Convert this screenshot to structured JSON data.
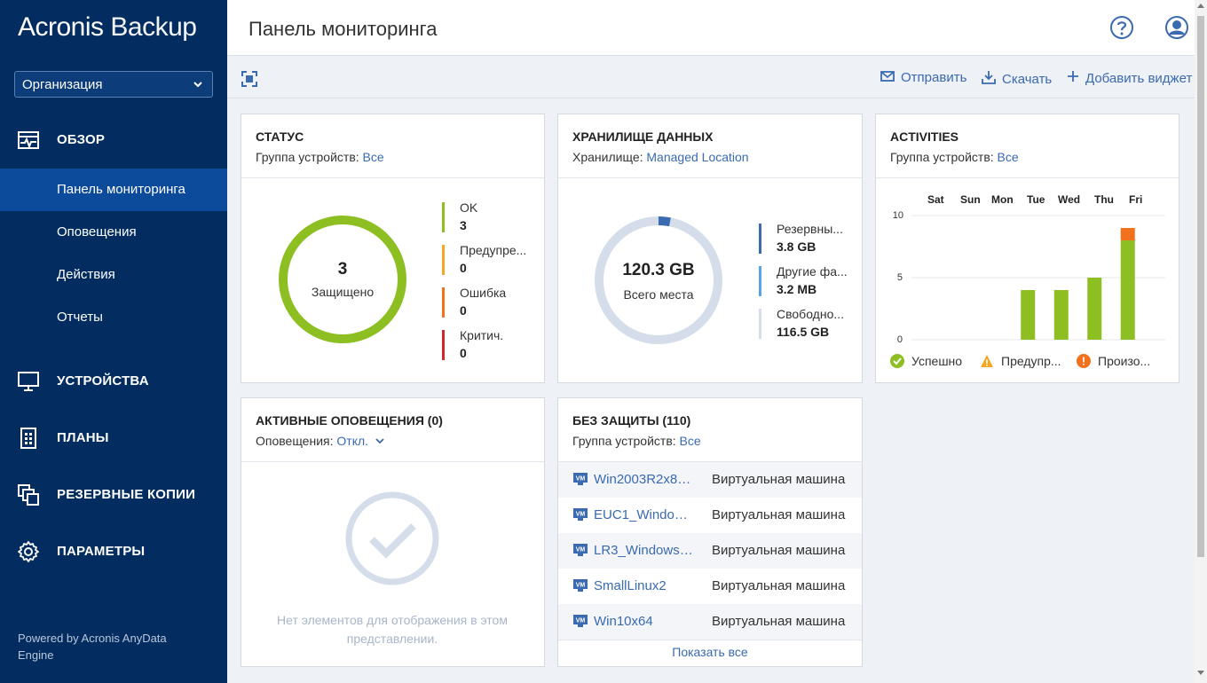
{
  "app": {
    "logo_part1": "Acronis",
    "logo_part2": "Backup"
  },
  "sidebar": {
    "org_select": "Организация",
    "sections": [
      {
        "label": "ОБЗОР",
        "icon": "monitor-pulse-icon"
      },
      {
        "label": "УСТРОЙСТВА",
        "icon": "desktop-icon"
      },
      {
        "label": "ПЛАНЫ",
        "icon": "plans-icon"
      },
      {
        "label": "РЕЗЕРВНЫЕ КОПИИ",
        "icon": "backups-icon"
      },
      {
        "label": "ПАРАМЕТРЫ",
        "icon": "gear-icon"
      }
    ],
    "sub_items": [
      {
        "label": "Панель мониторинга"
      },
      {
        "label": "Оповещения"
      },
      {
        "label": "Действия"
      },
      {
        "label": "Отчеты"
      }
    ],
    "powered": "Powered by Acronis AnyData Engine"
  },
  "header": {
    "title": "Панель мониторинга"
  },
  "toolbar": {
    "send": "Отправить",
    "download": "Скачать",
    "add_widget": "Добавить виджет"
  },
  "colors": {
    "accent": "#3a6ab0",
    "sidebar": "#032d60",
    "ok": "#8dbf22",
    "warning": "#f5a623",
    "error": "#f2711c",
    "critical": "#d0272f",
    "storage_used": "#3a6ab0",
    "storage_other": "#56a5e8",
    "storage_free": "#d4dde9"
  },
  "status_card": {
    "title": "СТАТУС",
    "sub_label": "Группа устройств:",
    "sub_link": "Все",
    "center_value": "3",
    "center_label": "Защищено",
    "legend": [
      {
        "label": "OK",
        "value": "3"
      },
      {
        "label": "Предупре...",
        "value": "0"
      },
      {
        "label": "Ошибка",
        "value": "0"
      },
      {
        "label": "Критич.",
        "value": "0"
      }
    ]
  },
  "storage_card": {
    "title": "ХРАНИЛИЩЕ ДАННЫХ",
    "sub_label": "Хранилище:",
    "sub_link": "Managed Location",
    "center_value": "120.3 GB",
    "center_label": "Всего места",
    "legend": [
      {
        "label": "Резервны...",
        "value": "3.8 GB"
      },
      {
        "label": "Другие фа...",
        "value": "3.2 MB"
      },
      {
        "label": "Свободно...",
        "value": "116.5 GB"
      }
    ]
  },
  "activities_card": {
    "title": "ACTIVITIES",
    "sub_label": "Группа устройств:",
    "sub_link": "Все",
    "legend": [
      {
        "label": "Успешно"
      },
      {
        "label": "Предупр..."
      },
      {
        "label": "Произо..."
      }
    ]
  },
  "chart_data": {
    "type": "bar",
    "categories": [
      "Sat",
      "Sun",
      "Mon",
      "Tue",
      "Wed",
      "Thu",
      "Fri"
    ],
    "series": [
      {
        "name": "Успешно",
        "values": [
          0,
          0,
          0,
          4,
          4,
          5,
          8
        ]
      },
      {
        "name": "Произо...",
        "values": [
          0,
          0,
          0,
          0,
          0,
          0,
          1
        ]
      }
    ],
    "ylim": [
      0,
      10
    ],
    "yticks": [
      "10",
      "5",
      "0"
    ],
    "grid": true,
    "legend": "bottom"
  },
  "alerts_card": {
    "title": "АКТИВНЫЕ ОПОВЕЩЕНИЯ (0)",
    "sub_label": "Оповещения:",
    "sub_link": "Откл.",
    "empty_text": "Нет элементов для отображения в этом представлении."
  },
  "unprotected_card": {
    "title": "БЕЗ ЗАЩИТЫ (110)",
    "sub_label": "Группа устройств:",
    "sub_link": "Все",
    "rows": [
      {
        "name": "Win2003R2x86 (...",
        "type": "Виртуальная машина"
      },
      {
        "name": "EUC1_Windows...",
        "type": "Виртуальная машина"
      },
      {
        "name": "LR3_Windows7_...",
        "type": "Виртуальная машина"
      },
      {
        "name": "SmallLinux2",
        "type": "Виртуальная машина"
      },
      {
        "name": "Win10x64",
        "type": "Виртуальная машина"
      }
    ],
    "vm_icon_text": "VM",
    "show_all": "Показать все"
  }
}
